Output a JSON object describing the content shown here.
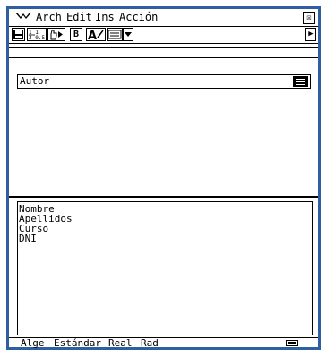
{
  "menubar": {
    "logo_icon": "casio-menu-icon",
    "items": [
      "Arch",
      "Edit",
      "Ins",
      "Acción"
    ],
    "close_glyph": "☒"
  },
  "toolbar": {
    "buttons": [
      {
        "name": "save-icon"
      },
      {
        "name": "fraction-decimal-icon"
      },
      {
        "name": "pointer-run-icon"
      },
      {
        "label": "B"
      },
      {
        "name": "font-style-icon"
      },
      {
        "name": "keyboard-icon"
      },
      {
        "name": "dropdown-arrow-icon"
      }
    ],
    "scroll_glyph": "▶"
  },
  "main": {
    "field_value": "Autor"
  },
  "list": {
    "items": [
      "Nombre",
      "Apellidos",
      "Curso",
      "DNI"
    ]
  },
  "status": {
    "mode": "Alge",
    "format": "Estándar",
    "number": "Real",
    "angle": "Rad",
    "battery_icon": "battery-icon"
  }
}
